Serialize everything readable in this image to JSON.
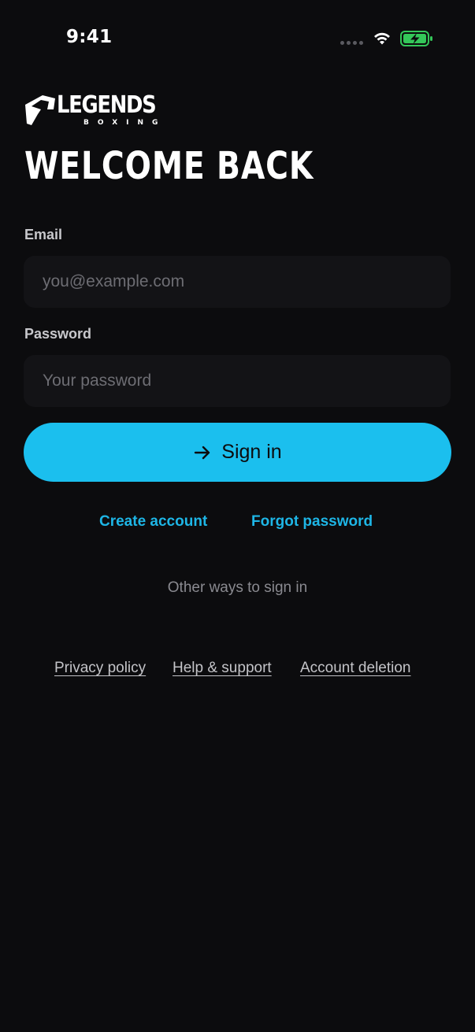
{
  "status_bar": {
    "time": "9:41"
  },
  "logo": {
    "wordmark": "LEGENDS",
    "subtitle": "BOXING"
  },
  "title": "WELCOME BACK",
  "form": {
    "email_label": "Email",
    "email_placeholder": "you@example.com",
    "email_value": "",
    "password_label": "Password",
    "password_placeholder": "Your password",
    "password_value": "",
    "submit_label": "Sign in"
  },
  "links": {
    "create_account": "Create account",
    "forgot_password": "Forgot password"
  },
  "other_ways": "Other ways to sign in",
  "footer": {
    "privacy": "Privacy policy",
    "help": "Help & support",
    "deletion": "Account deletion"
  },
  "colors": {
    "background": "#0c0c0e",
    "accent": "#1bbfee",
    "field_bg": "#131316",
    "battery_green": "#34c759"
  },
  "icons": {
    "status": [
      "signal-dots-icon",
      "wifi-icon",
      "battery-charging-icon"
    ],
    "button": "arrow-right-icon"
  }
}
